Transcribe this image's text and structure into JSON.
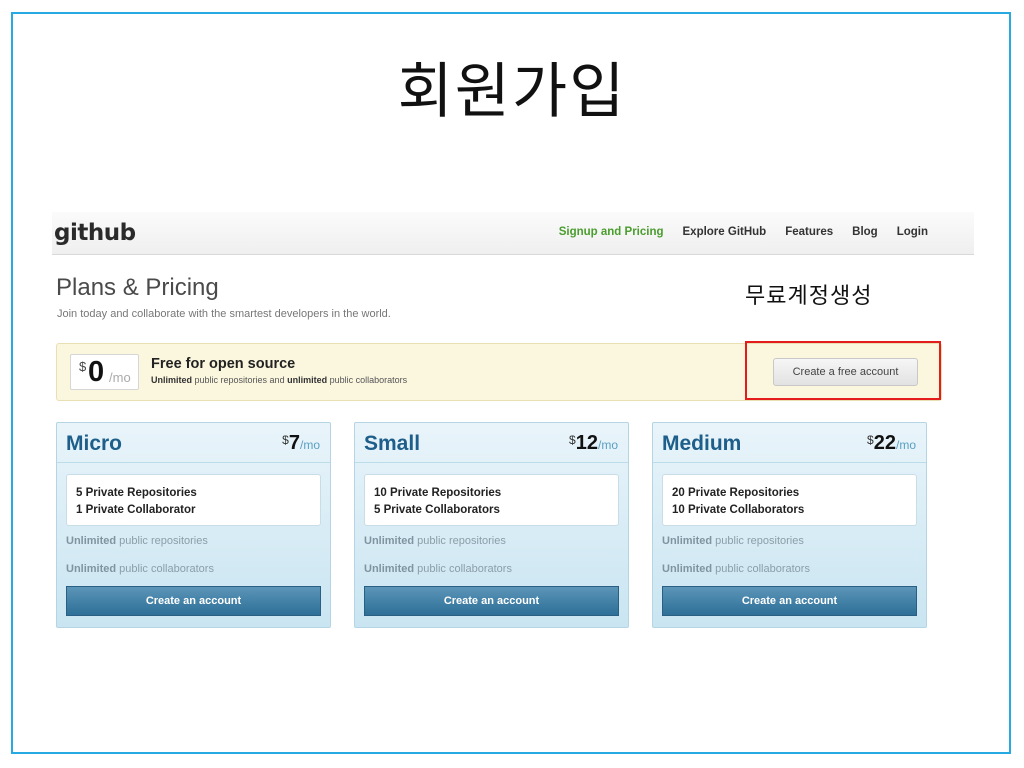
{
  "slide": {
    "title": "회원가입",
    "annotation": "무료계정생성"
  },
  "navbar": {
    "logo": "github",
    "links": [
      "Signup and Pricing",
      "Explore GitHub",
      "Features",
      "Blog",
      "Login"
    ]
  },
  "header": {
    "title": "Plans & Pricing",
    "subtitle": "Join today and collaborate with the smartest developers in the world."
  },
  "free_plan": {
    "currency": "$",
    "amount": "0",
    "period": "/mo",
    "heading": "Free for open source",
    "desc_part1": "Unlimited",
    "desc_part2": " public repositories and ",
    "desc_part3": "unlimited",
    "desc_part4": " public collaborators",
    "button": "Create a free account"
  },
  "plans": [
    {
      "name": "Micro",
      "currency": "$",
      "amount": "7",
      "period": "/mo",
      "feature1": "5 Private Repositories",
      "feature2": "1 Private Collaborator",
      "unlimited": "Unlimited",
      "line1": " public repositories",
      "line2": " public collaborators",
      "button": "Create an account"
    },
    {
      "name": "Small",
      "currency": "$",
      "amount": "12",
      "period": "/mo",
      "feature1": "10 Private Repositories",
      "feature2": "5 Private Collaborators",
      "unlimited": "Unlimited",
      "line1": " public repositories",
      "line2": " public collaborators",
      "button": "Create an account"
    },
    {
      "name": "Medium",
      "currency": "$",
      "amount": "22",
      "period": "/mo",
      "feature1": "20 Private Repositories",
      "feature2": "10 Private Collaborators",
      "unlimited": "Unlimited",
      "line1": " public repositories",
      "line2": " public collaborators",
      "button": "Create an account"
    }
  ],
  "colors": {
    "frame": "#27a9e1",
    "active_nav": "#4a9d2e",
    "highlight": "#e41c1c",
    "plan_button": "#2d6f97"
  }
}
